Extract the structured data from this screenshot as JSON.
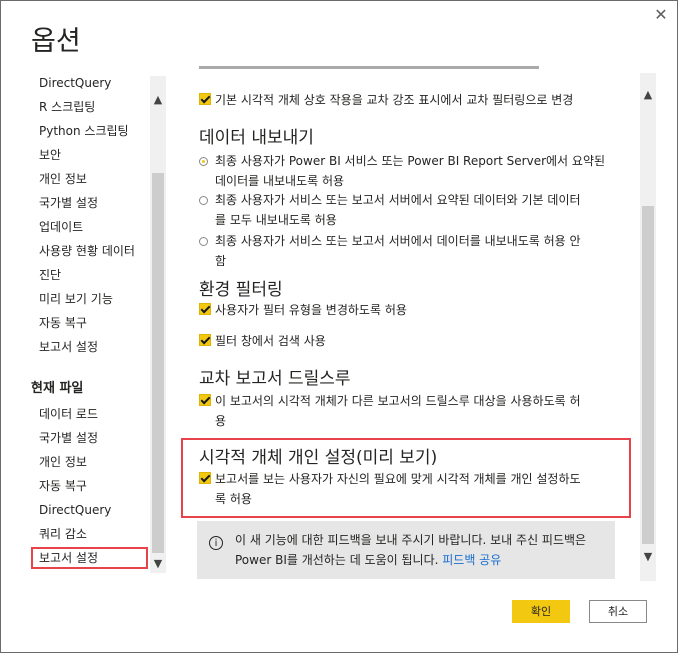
{
  "dialog": {
    "title": "옵션",
    "close_glyph": "✕"
  },
  "leftnav": {
    "items_top": [
      "DirectQuery",
      "R 스크립팅",
      "Python 스크립팅",
      "보안",
      "개인 정보",
      "국가별 설정",
      "업데이트",
      "사용량 현황 데이터",
      "진단",
      "미리 보기 기능",
      "자동 복구",
      "보고서 설정"
    ],
    "current_file_heading": "현재 파일",
    "items_file": [
      "데이터 로드",
      "국가별 설정",
      "개인 정보",
      "자동 복구",
      "DirectQuery",
      "쿼리 감소",
      "보고서 설정"
    ]
  },
  "content": {
    "cross_filter_label": "기본 시각적 개체 상호 작용을 교차 강조 표시에서 교차 필터링으로 변경",
    "export_heading": "데이터 내보내기",
    "export_options": [
      {
        "line1": "최종 사용자가 Power BI 서비스 또는 Power BI Report Server에서 요약된",
        "line2": "데이터를 내보내도록 허용",
        "selected": true
      },
      {
        "line1": "최종 사용자가 서비스 또는 보고서 서버에서 요약된 데이터와 기본 데이터",
        "line2": "를 모두 내보내도록 허용",
        "selected": false
      },
      {
        "line1": "최종 사용자가 서비스 또는 보고서 서버에서 데이터를 내보내도록 허용 안",
        "line2": "함",
        "selected": false
      }
    ],
    "filter_heading": "환경 필터링",
    "filter_opt1": "사용자가 필터 유형을 변경하도록 허용",
    "filter_opt2": "필터 창에서 검색 사용",
    "drill_heading": "교차 보고서 드릴스루",
    "drill_opt_line1": "이 보고서의 시각적 개체가 다른 보고서의 드릴스루 대상을 사용하도록 허",
    "drill_opt_line2": "용",
    "personal_heading": "시각적 개체 개인 설정(미리 보기)",
    "personal_opt_line1": "보고서를 보는 사용자가 자신의 필요에 맞게 시각적 개체를 개인 설정하도",
    "personal_opt_line2": "록 허용",
    "feedback_line1": "이 새 기능에 대한 피드백을 보내 주시기 바랍니다. 보내 주신 피드백은",
    "feedback_line2": "Power BI를 개선하는 데 도움이 됩니다. ",
    "feedback_link": "피드백 공유",
    "info_glyph": "i"
  },
  "buttons": {
    "ok": "확인",
    "cancel": "취소"
  },
  "colors": {
    "accent": "#f2c811",
    "highlight": "#e8434b",
    "link": "#1a6dd1"
  }
}
